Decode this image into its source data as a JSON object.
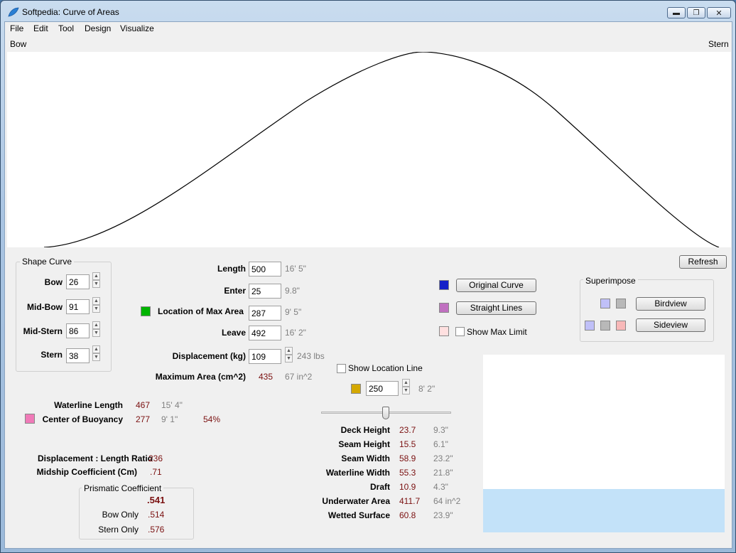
{
  "window": {
    "title": "Softpedia: Curve of Areas"
  },
  "menu": [
    "File",
    "Edit",
    "Tool",
    "Design",
    "Visualize"
  ],
  "graph": {
    "left_label": "Bow",
    "right_label": "Stern"
  },
  "shape_curve": {
    "title": "Shape Curve",
    "bow": {
      "label": "Bow",
      "value": "26"
    },
    "mid_bow": {
      "label": "Mid-Bow",
      "value": "91"
    },
    "mid_stern": {
      "label": "Mid-Stern",
      "value": "86"
    },
    "stern": {
      "label": "Stern",
      "value": "38"
    }
  },
  "dimensions": {
    "length": {
      "label": "Length",
      "value": "500",
      "imperial": "16' 5\""
    },
    "enter": {
      "label": "Enter",
      "value": "25",
      "imperial": "9.8\""
    },
    "max_area_loc": {
      "label": "Location of Max Area",
      "value": "287",
      "imperial": "9' 5\"",
      "color": "#00b400"
    },
    "leave": {
      "label": "Leave",
      "value": "492",
      "imperial": "16' 2\""
    },
    "displacement": {
      "label": "Displacement (kg)",
      "value": "109",
      "imperial": "243 lbs"
    },
    "max_area": {
      "label": "Maximum Area (cm^2)",
      "value": "435",
      "imperial": "67 in^2"
    }
  },
  "waterline": {
    "length": {
      "label": "Waterline Length",
      "value": "467",
      "imperial": "15' 4\""
    },
    "buoyancy": {
      "label": "Center of Buoyancy",
      "value": "277",
      "imperial": "9' 1\"",
      "percent": "54%",
      "color": "#f07ab8"
    }
  },
  "ratios": {
    "disp_length": {
      "label": "Displacement : Length Ratio",
      "value": "236"
    },
    "midship": {
      "label": "Midship Coefficient (Cm)",
      "value": ".71"
    }
  },
  "prismatic": {
    "title": "Prismatic Coefficient",
    "value": ".541",
    "bow": {
      "label": "Bow Only",
      "value": ".514"
    },
    "stern": {
      "label": "Stern Only",
      "value": ".576"
    }
  },
  "location_line": {
    "label": "Show Location Line",
    "value": "250",
    "imperial": "8' 2\"",
    "color": "#d4a800"
  },
  "curve_buttons": {
    "original": {
      "label": "Original Curve",
      "color": "#1420c8"
    },
    "straight": {
      "label": "Straight Lines",
      "color": "#c070c0"
    },
    "max_limit": {
      "label": "Show Max Limit",
      "color": "#ffe0e0"
    }
  },
  "refresh_label": "Refresh",
  "superimpose": {
    "title": "Superimpose",
    "birdview_label": "Birdview",
    "sideview_label": "Sideview",
    "colors": [
      "#c0c0f8",
      "#b8b8b8",
      "#f8b8b8"
    ]
  },
  "measurements": [
    {
      "label": "Deck Height",
      "value": "23.7",
      "imperial": "9.3\""
    },
    {
      "label": "Seam Height",
      "value": "15.5",
      "imperial": "6.1\""
    },
    {
      "label": "Seam Width",
      "value": "58.9",
      "imperial": "23.2\""
    },
    {
      "label": "Waterline Width",
      "value": "55.3",
      "imperial": "21.8\""
    },
    {
      "label": "Draft",
      "value": "10.9",
      "imperial": "4.3\""
    },
    {
      "label": "Underwater Area",
      "value": "411.7",
      "imperial": "64 in^2"
    },
    {
      "label": "Wetted Surface",
      "value": "60.8",
      "imperial": "23.9\""
    }
  ]
}
